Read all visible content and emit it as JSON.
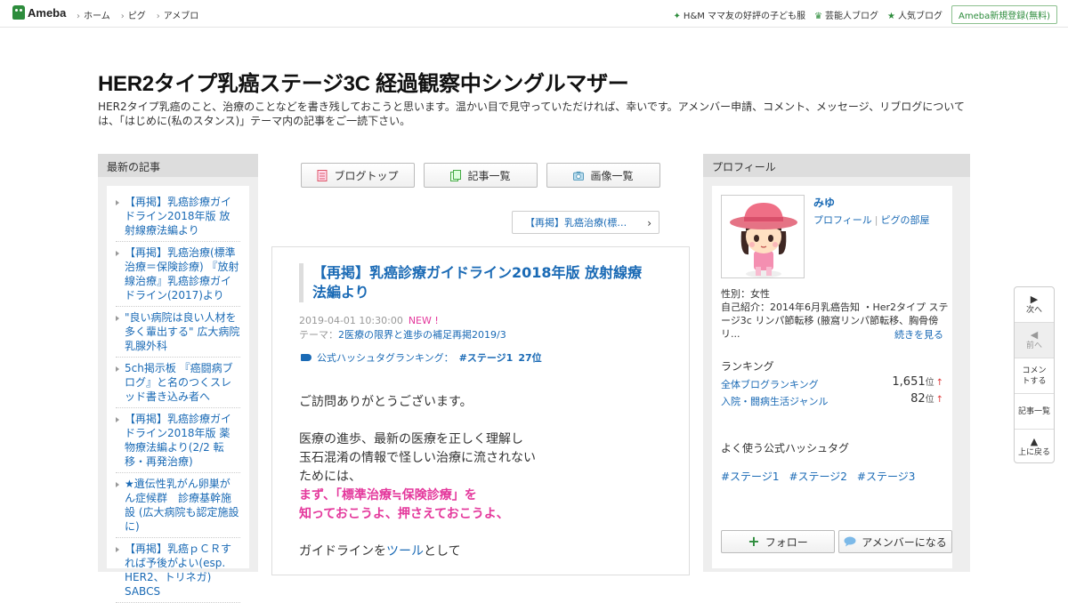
{
  "topbar": {
    "logo": "Ameba",
    "nav": [
      "ホーム",
      "ピグ",
      "アメブロ"
    ],
    "right_links": [
      "H&M ママ友の好評の子ども服",
      "芸能人ブログ",
      "人気ブログ"
    ],
    "register": "Ameba新規登録(無料)"
  },
  "header": {
    "title": "HER2タイプ乳癌ステージ3C 経過観察中シングルマザー",
    "description": "HER2タイプ乳癌のこと、治療のことなどを書き残しておこうと思います。温かい目で見守っていただければ、幸いです。アメンバー申請、コメント、メッセージ、リブログについては、「はじめに(私のスタンス)」テーマ内の記事をご一読下さい。"
  },
  "left": {
    "heading": "最新の記事",
    "items": [
      "【再掲】乳癌診療ガイドライン2018年版 放射線療法編より",
      "【再掲】乳癌治療(標準治療＝保険診療) 『放射線治療』乳癌診療ガイドライン(2017)より",
      "\"良い病院は良い人材を多く輩出する\" 広大病院乳腺外科",
      "5ch掲示板 『癌闘病ブログ』と名のつくスレッド書き込み者へ",
      "【再掲】乳癌診療ガイドライン2018年版 薬物療法編より(2/2 転移・再発治療)",
      "★遺伝性乳がん卵巣がん症候群　診療基幹施設 (広大病院も認定施設に)",
      "【再掲】乳癌ｐＣＲすれば予後がよい(esp. HER2、トリネガ) SABCS"
    ]
  },
  "center": {
    "tabs": [
      "ブログトップ",
      "記事一覧",
      "画像一覧"
    ],
    "prev_entry": "【再掲】乳癌治療(標…",
    "entry": {
      "title": "【再掲】乳癌診療ガイドライン2018年版 放射線療法編より",
      "date": "2019-04-01 10:30:00",
      "new_label": "NEW !",
      "theme_label": "テーマ：",
      "theme": "2医療の限界と進歩の補足再掲2019/3",
      "hashtag_label": "公式ハッシュタグランキング：",
      "hashtag": "#ステージ1",
      "hashtag_rank": "27位",
      "body": {
        "line1": "ご訪問ありがとうございます。",
        "line2": "医療の進歩、最新の医療を正しく理解し",
        "line3": "玉石混淆の情報で怪しい治療に流されない",
        "line4": "ためには、",
        "line5": "まず、「標準治療≒保険診療」を",
        "line6": "知っておこうよ、押さえておこうよ、",
        "line7_pre": "ガイドラインを",
        "line7_link": "ツール",
        "line7_post": "として"
      }
    }
  },
  "right": {
    "heading": "プロフィール",
    "name": "みゆ",
    "link_profile": "プロフィール",
    "link_pig": "ピグの部屋",
    "gender": "性別：女性",
    "intro": "自己紹介：2014年6月乳癌告知 ・Her2タイプ ステージ3c リンパ節転移 (腋窩リンパ節転移、胸骨傍リ...",
    "more": "続きを見る",
    "ranking_title": "ランキング",
    "rankings": [
      {
        "label": "全体ブログランキング",
        "value": "1,651",
        "unit": "位",
        "arrow": "↑"
      },
      {
        "label": "入院・闘病生活ジャンル",
        "value": "82",
        "unit": "位",
        "arrow": "↑"
      }
    ],
    "hashtag_title": "よく使う公式ハッシュタグ",
    "hashtags": [
      "#ステージ1",
      "#ステージ2",
      "#ステージ3"
    ],
    "follow": "フォロー",
    "amember": "アメンバーになる"
  },
  "floatnav": {
    "next": "次へ",
    "prev": "前へ",
    "comment": "コメントする",
    "list": "記事一覧",
    "top": "上に戻る"
  },
  "colors": {
    "accent": "#2d8c3c",
    "link": "#1a6ab5",
    "pink": "#e4389c"
  }
}
